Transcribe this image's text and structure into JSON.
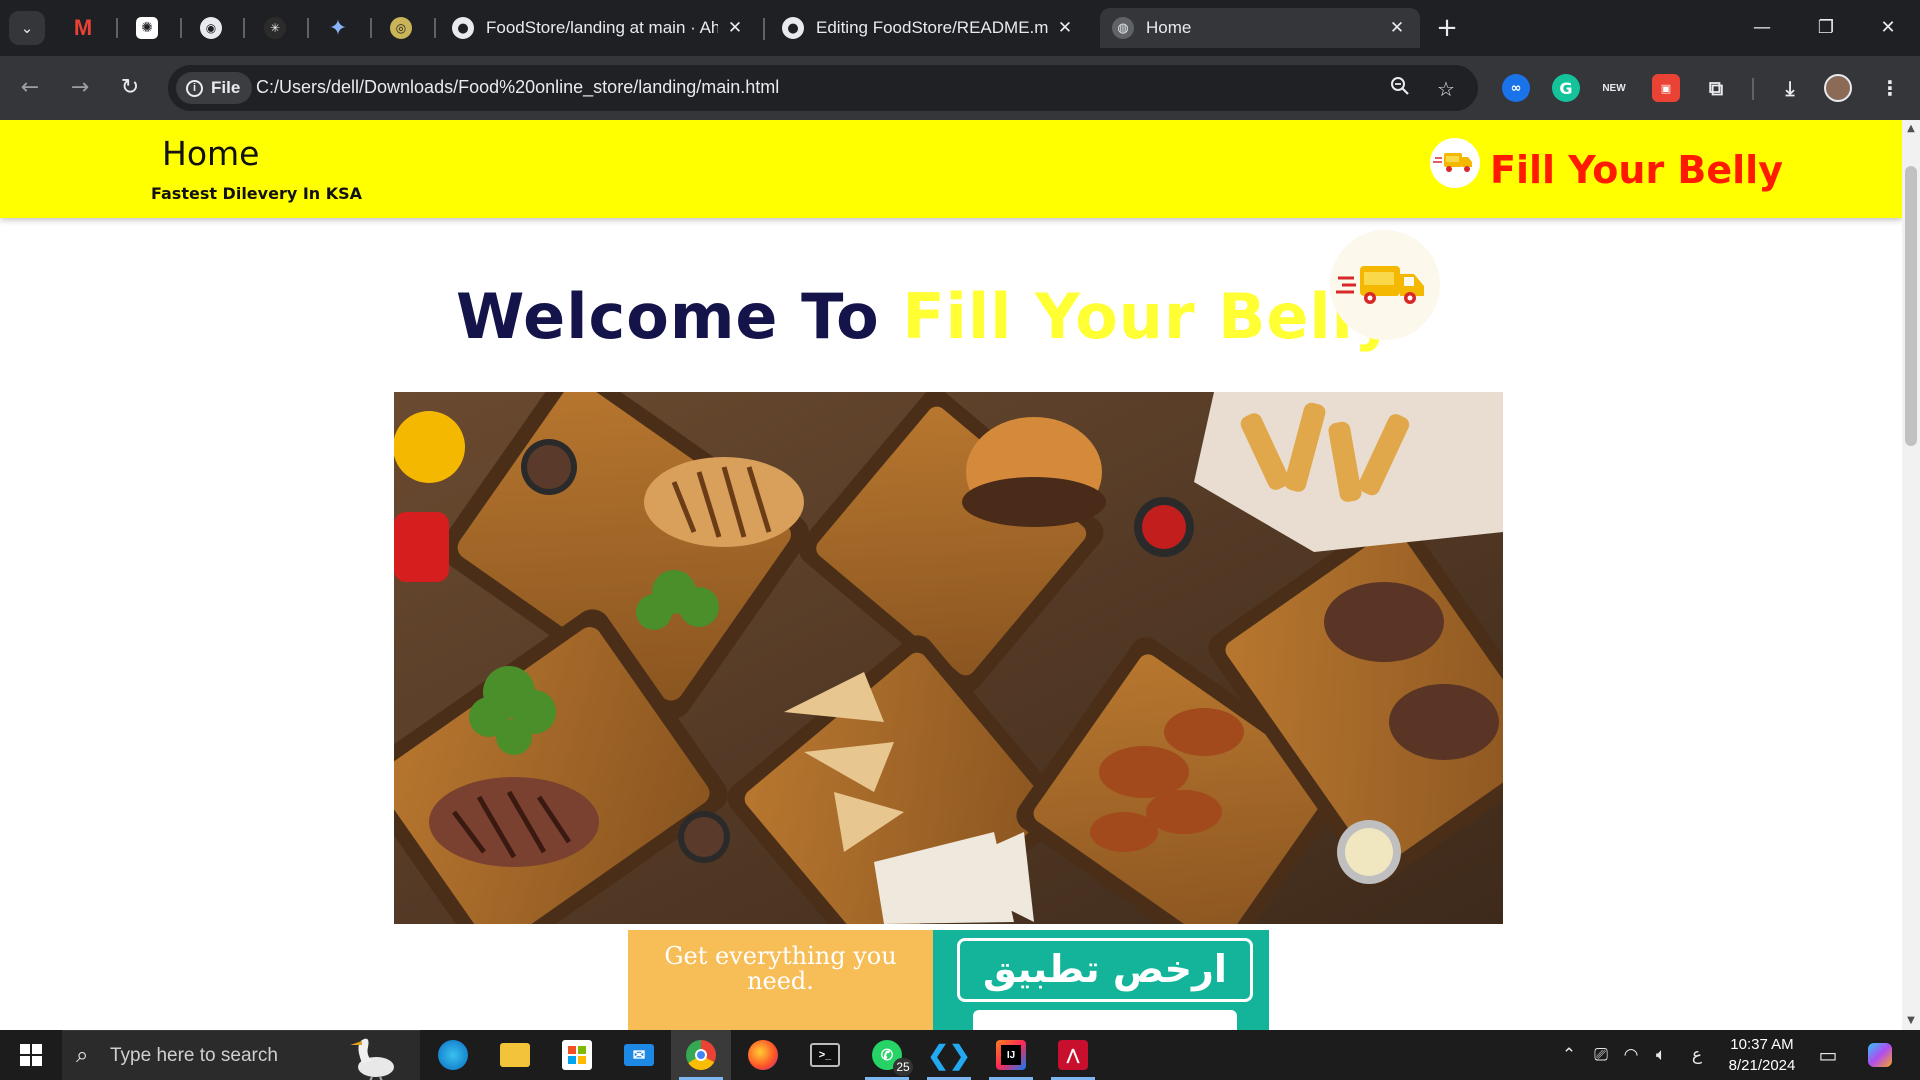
{
  "browser": {
    "pinned_tabs": [
      {
        "icon": "gmail-icon",
        "glyph": "M"
      },
      {
        "icon": "chatgpt-icon",
        "glyph": "✺"
      },
      {
        "icon": "bot-icon",
        "glyph": "◉"
      },
      {
        "icon": "perplexity-icon",
        "glyph": "✳"
      },
      {
        "icon": "gemini-icon",
        "glyph": "✦"
      },
      {
        "icon": "copilot-icon",
        "glyph": "◎"
      }
    ],
    "tabs": [
      {
        "title": "FoodStore/landing at main · Ah",
        "close": "✕"
      },
      {
        "title": "Editing FoodStore/README.md",
        "close": "✕"
      },
      {
        "title": "Home",
        "close": "✕"
      }
    ],
    "new_tab": "+",
    "address": {
      "chip": "File",
      "url": "C:/Users/dell/Downloads/Food%20online_store/landing/main.html"
    },
    "ext_new_label": "NEW",
    "colors": {
      "tab_strip": "#1f2023",
      "toolbar": "#35363a"
    }
  },
  "page": {
    "header": {
      "title": "Home",
      "subtitle": "Fastest Dilevery In KSA",
      "brand": "Fill Your Belly"
    },
    "hero": {
      "welcome": "Welcome To",
      "welcome_highlight": "Fill Your Belly"
    },
    "promo": {
      "left_text": "Get everything you need.",
      "right_button": "ارخص تطبيق"
    },
    "colors": {
      "header_bg": "#ffff00",
      "brand": "#ff1a00",
      "welcome": "#14144a",
      "highlight": "#ffff33"
    }
  },
  "taskbar": {
    "search_placeholder": "Type here to search",
    "apps": [
      {
        "name": "edge"
      },
      {
        "name": "file-explorer"
      },
      {
        "name": "microsoft-store"
      },
      {
        "name": "mail"
      },
      {
        "name": "chrome"
      },
      {
        "name": "firefox"
      },
      {
        "name": "terminal"
      },
      {
        "name": "whatsapp",
        "badge": "25"
      },
      {
        "name": "vscode"
      },
      {
        "name": "intellij"
      },
      {
        "name": "acrobat"
      }
    ],
    "language": "ع",
    "time": "10:37 AM",
    "date": "8/21/2024"
  }
}
